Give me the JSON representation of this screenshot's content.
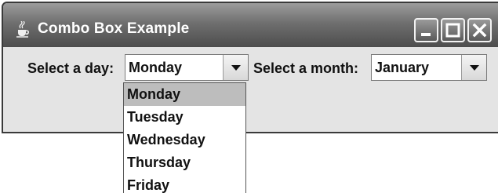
{
  "window": {
    "title": "Combo Box Example",
    "title_icon": "java-cup-icon",
    "controls": [
      "minimize-icon",
      "maximize-icon",
      "close-icon"
    ]
  },
  "day_selector": {
    "label": "Select a day:",
    "selected": "Monday",
    "options": [
      "Monday",
      "Tuesday",
      "Wednesday",
      "Thursday",
      "Friday"
    ],
    "expanded": true
  },
  "month_selector": {
    "label": "Select a month:",
    "selected": "January",
    "expanded": false
  },
  "colors": {
    "titlebar": "#6f6f6f",
    "panel": "#e4e4e4",
    "selection": "#bdbdbd"
  }
}
